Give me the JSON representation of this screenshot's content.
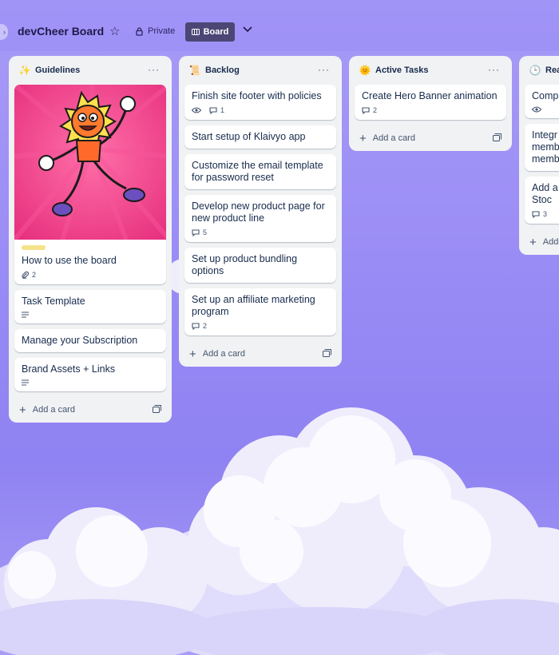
{
  "board": {
    "title": "devCheer Board",
    "visibility": "Private",
    "view_label": "Board",
    "accent": "#4c4675"
  },
  "icons": {
    "star": "star-icon",
    "lock": "lock-icon",
    "board": "board-view-icon",
    "chevron": "chevron-down-icon",
    "comment": "comment-icon",
    "watch": "eye-icon",
    "attachment": "paperclip-icon",
    "description": "description-icon",
    "template": "template-icon"
  },
  "lists": [
    {
      "title": "Guidelines",
      "emoji": "✨",
      "menu": "···",
      "add_label": "Add a card",
      "cards": [
        {
          "title": "How to use the board",
          "label_color": "#f5e28a",
          "attachments": "2"
        },
        {
          "title": "Task Template"
        },
        {
          "title": "Manage your Subscription"
        },
        {
          "title": "Brand Assets + Links"
        }
      ]
    },
    {
      "title": "Backlog",
      "emoji": "📜",
      "menu": "···",
      "add_label": "Add a card",
      "cards": [
        {
          "title": "Finish site footer with policies",
          "comments": "1"
        },
        {
          "title": "Start setup of Klaivyo app"
        },
        {
          "title": "Customize the email template for password reset"
        },
        {
          "title": "Develop new product page for new product line",
          "comments": "5"
        },
        {
          "title": "Set up product bundling options"
        },
        {
          "title": "Set up an affiliate marketing program",
          "comments": "2"
        }
      ]
    },
    {
      "title": "Active Tasks",
      "emoji": "🌞",
      "menu": "···",
      "add_label": "Add a card",
      "cards": [
        {
          "title": "Create Hero Banner animation",
          "comments": "2"
        }
      ]
    },
    {
      "title": "Rea",
      "emoji": "🕒",
      "add_label": "Add",
      "cards": [
        {
          "title": "Comp"
        },
        {
          "title": "Integr memb memb"
        },
        {
          "title": "Add a in Stoc",
          "comments": "3"
        }
      ]
    }
  ]
}
